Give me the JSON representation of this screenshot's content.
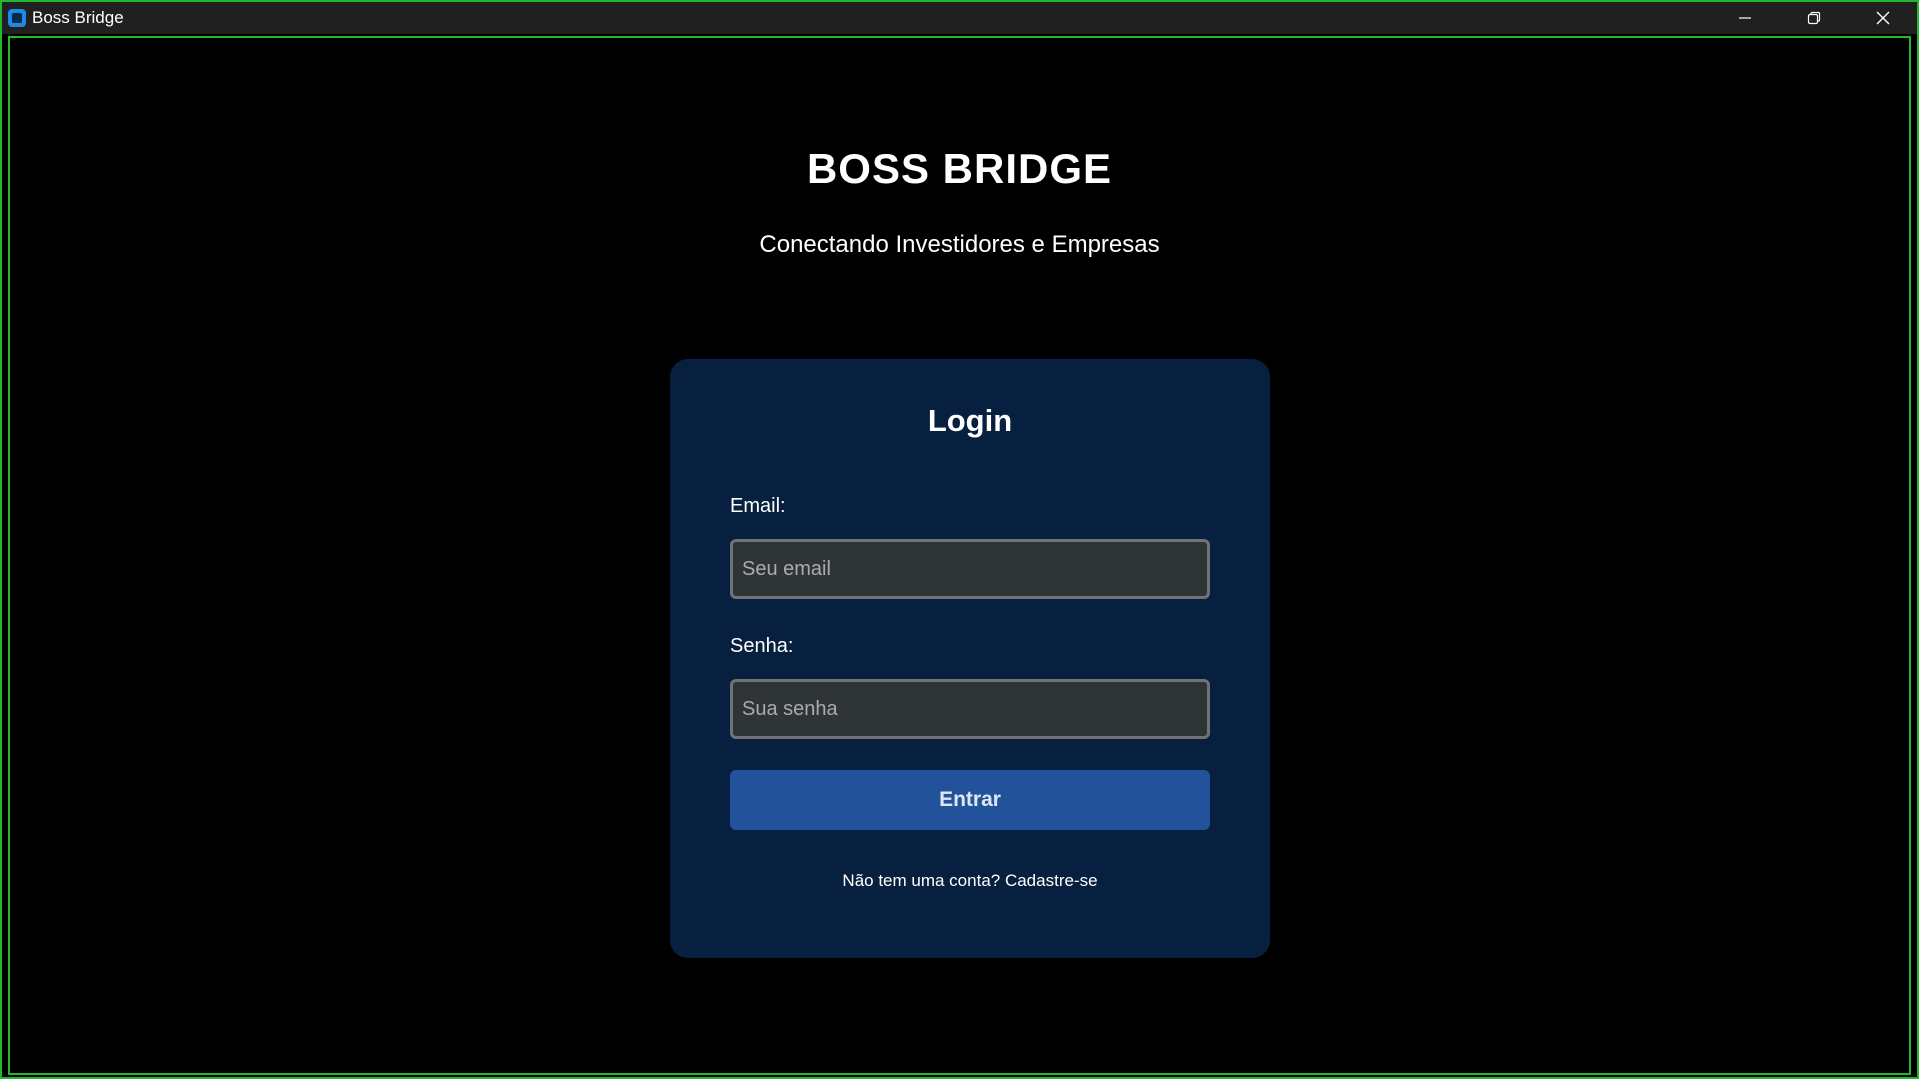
{
  "window": {
    "title": "Boss Bridge",
    "controls": [
      "minimize-icon",
      "restore-icon",
      "close-icon"
    ]
  },
  "header": {
    "title": "BOSS BRIDGE",
    "subtitle": "Conectando Investidores e Empresas"
  },
  "login": {
    "title": "Login",
    "email_label": "Email:",
    "email_placeholder": "Seu email",
    "email_value": "",
    "password_label": "Senha:",
    "password_placeholder": "Sua senha",
    "password_value": "",
    "submit_label": "Entrar",
    "signup_prompt": "Não tem uma conta?",
    "signup_link": "Cadastre-se"
  },
  "colors": {
    "background": "#000000",
    "card": "#07203f",
    "button": "#22539a",
    "input": "#2f3436",
    "frame_border": "#1fb82f"
  }
}
